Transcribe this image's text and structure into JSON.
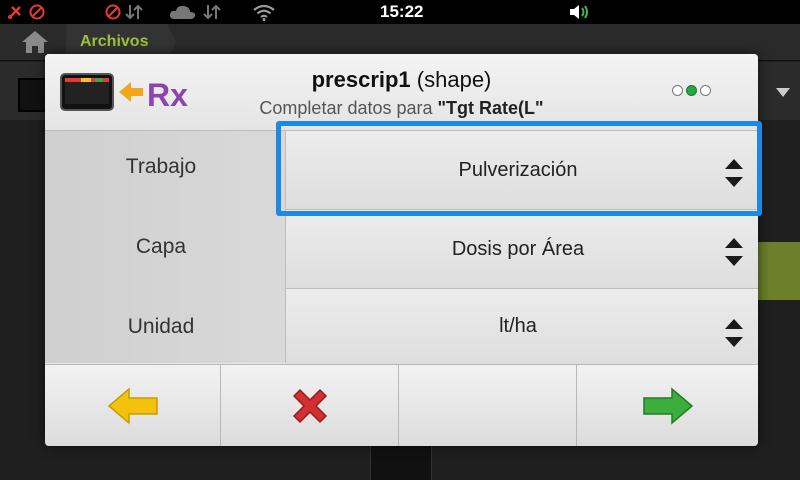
{
  "status_bar": {
    "time": "15:22",
    "icons": [
      "gps-off-icon",
      "no-signal-icon",
      "no-sync-icon",
      "cloud-sync-icon",
      "wifi-icon",
      "volume-icon"
    ]
  },
  "breadcrumb": {
    "home_icon": "home-icon",
    "crumb": "Archivos"
  },
  "dialog": {
    "title_bold": "prescrip1",
    "title_rest": " (shape)",
    "subtitle_prefix": "Completar datos para ",
    "subtitle_quoted": "\"Tgt Rate(L\"",
    "logo_text": "Rx",
    "pager": {
      "total": 3,
      "active": 2
    },
    "rows": [
      {
        "label": "Trabajo",
        "value": "Pulverización",
        "selected": true
      },
      {
        "label": "Capa",
        "value": "Dosis por Área",
        "selected": false
      },
      {
        "label": "Unidad",
        "value": "lt/ha",
        "selected": false
      }
    ],
    "footer": {
      "back_icon": "arrow-left-icon",
      "cancel_icon": "close-icon",
      "next_icon": "arrow-right-icon"
    },
    "colors": {
      "highlight": "#1e88e5",
      "back_arrow": "#f4c20d",
      "cancel": "#d32f2f",
      "next_arrow": "#3cae3c",
      "pager_active": "#28a745"
    }
  }
}
